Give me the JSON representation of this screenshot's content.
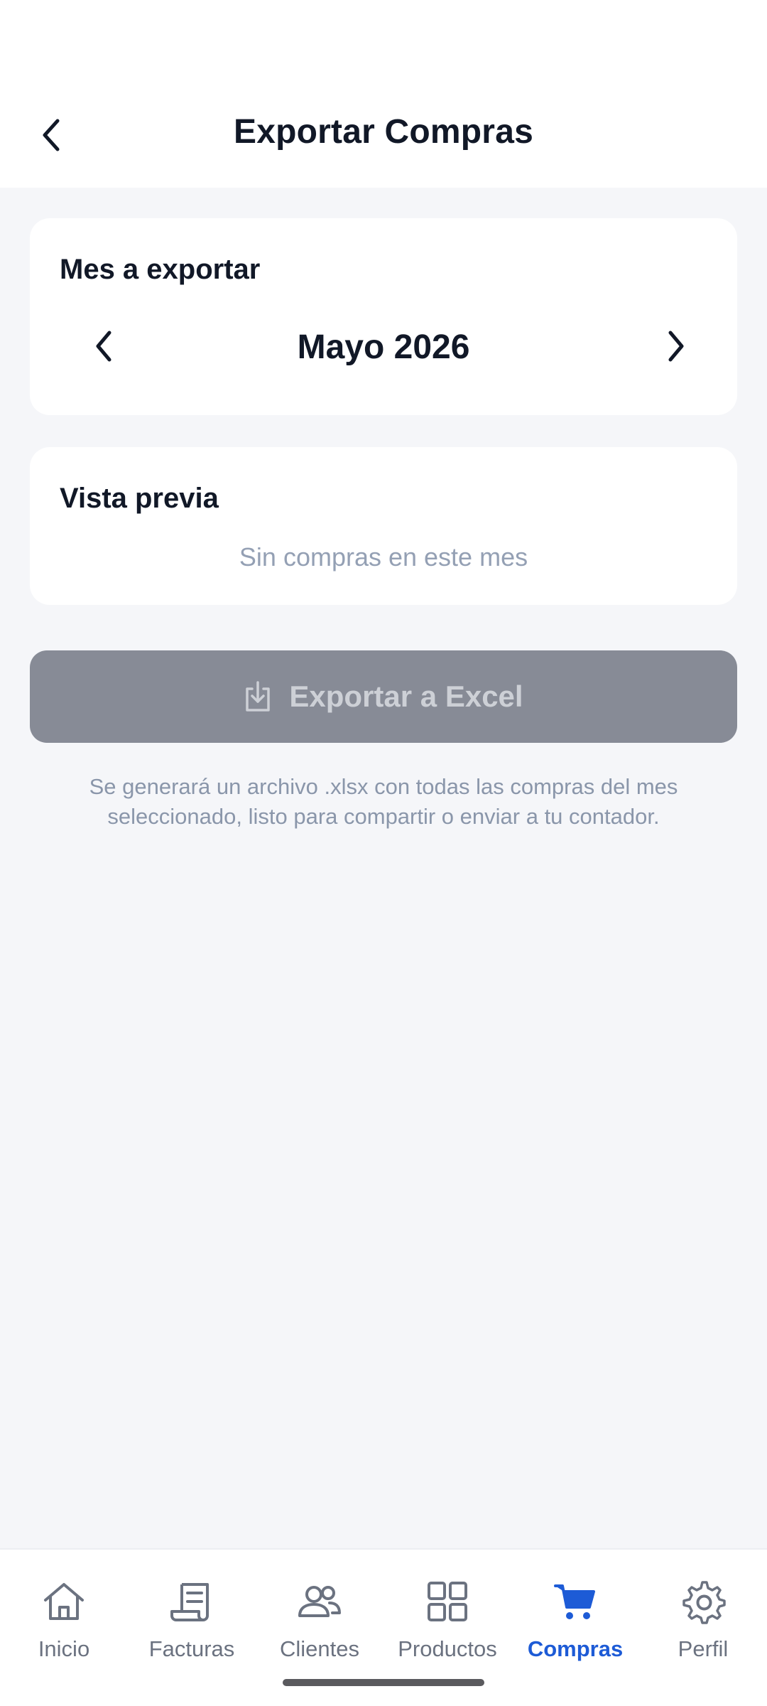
{
  "header": {
    "title": "Exportar Compras",
    "back_icon": "chevron-left-icon"
  },
  "month_card": {
    "title": "Mes a exportar",
    "selected_month": "Mayo 2026"
  },
  "preview_card": {
    "title": "Vista previa",
    "empty_message": "Sin compras en este mes"
  },
  "export": {
    "button_label": "Exportar a Excel",
    "button_icon": "download-icon",
    "enabled": false,
    "hint": "Se generará un archivo .xlsx con todas las compras del mes seleccionado, listo para compartir o enviar a tu contador."
  },
  "bottom_nav": {
    "items": [
      {
        "label": "Inicio",
        "icon": "home-icon"
      },
      {
        "label": "Facturas",
        "icon": "receipt-icon"
      },
      {
        "label": "Clientes",
        "icon": "users-icon"
      },
      {
        "label": "Productos",
        "icon": "grid-icon"
      },
      {
        "label": "Compras",
        "icon": "cart-icon",
        "active": true
      },
      {
        "label": "Perfil",
        "icon": "gear-icon"
      }
    ]
  },
  "colors": {
    "accent": "#1d5bd6",
    "disabled_button": "#878b96",
    "background": "#f5f6f9",
    "muted_text": "#94a0b4"
  }
}
